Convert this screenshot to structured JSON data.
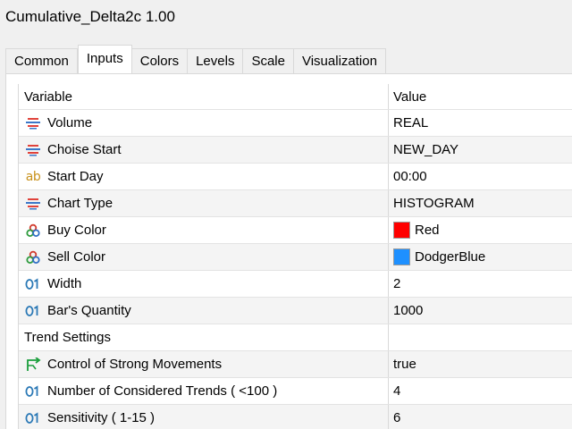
{
  "window": {
    "title": "Cumulative_Delta2c 1.00"
  },
  "tabs": [
    {
      "label": "Common"
    },
    {
      "label": "Inputs"
    },
    {
      "label": "Colors"
    },
    {
      "label": "Levels"
    },
    {
      "label": "Scale"
    },
    {
      "label": "Visualization"
    }
  ],
  "active_tab": "Inputs",
  "grid": {
    "columns": {
      "variable": "Variable",
      "value": "Value"
    },
    "rows": [
      {
        "icon": "enum-icon",
        "variable": "Volume",
        "value": "REAL"
      },
      {
        "icon": "enum-icon",
        "variable": "Choise Start",
        "value": "NEW_DAY"
      },
      {
        "icon": "string-icon",
        "variable": "Start Day",
        "value": "00:00"
      },
      {
        "icon": "enum-icon",
        "variable": "Chart Type",
        "value": "HISTOGRAM"
      },
      {
        "icon": "color-icon",
        "variable": "Buy Color",
        "value": "Red",
        "swatch": "#ff0000"
      },
      {
        "icon": "color-icon",
        "variable": "Sell Color",
        "value": "DodgerBlue",
        "swatch": "#1e90ff"
      },
      {
        "icon": "integer-icon",
        "variable": "Width",
        "value": "2"
      },
      {
        "icon": "integer-icon",
        "variable": "Bar's Quantity",
        "value": "1000"
      },
      {
        "icon": "none",
        "variable": "Trend Settings",
        "value": ""
      },
      {
        "icon": "boolean-icon",
        "variable": "Control of Strong Movements",
        "value": "true"
      },
      {
        "icon": "integer-icon",
        "variable": "Number of Considered Trends ( <100 )",
        "value": "4"
      },
      {
        "icon": "integer-icon",
        "variable": "Sensitivity ( 1-15 )",
        "value": "6"
      }
    ]
  },
  "colors": {
    "enum_red": "#e0433b",
    "enum_blue": "#3c78c8",
    "string": "#c8911b",
    "integer": "#2b79b6",
    "boolean": "#1a9e3c"
  }
}
